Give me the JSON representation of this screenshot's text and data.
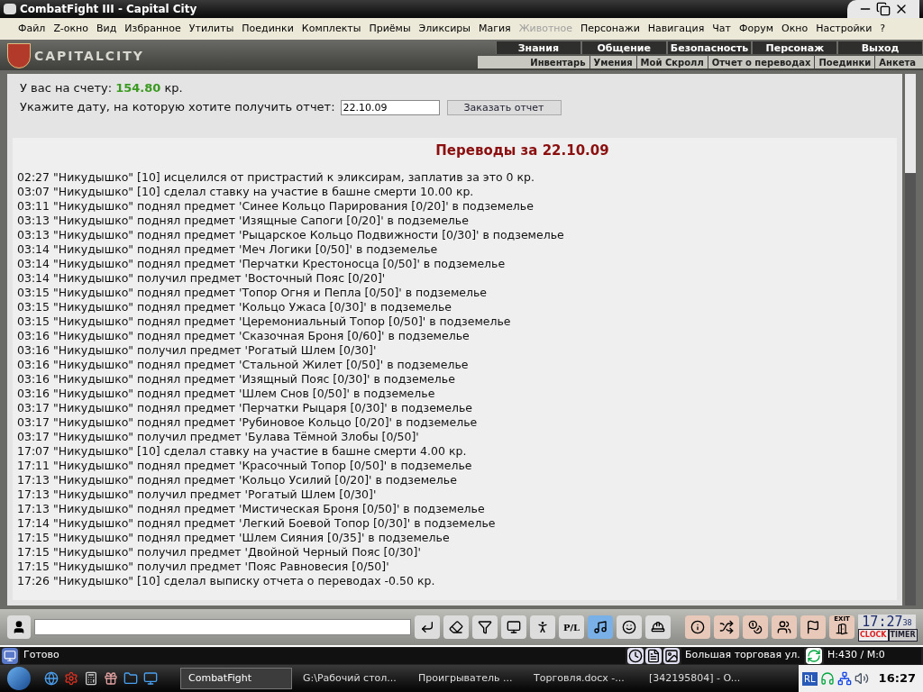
{
  "window": {
    "title": "CombatFight III - Capital City"
  },
  "menu": [
    {
      "label": "Файл",
      "disabled": false
    },
    {
      "label": "Z-окно",
      "disabled": false
    },
    {
      "label": "Вид",
      "disabled": false
    },
    {
      "label": "Избранное",
      "disabled": false
    },
    {
      "label": "Утилиты",
      "disabled": false
    },
    {
      "label": "Поединки",
      "disabled": false
    },
    {
      "label": "Комплекты",
      "disabled": false
    },
    {
      "label": "Приёмы",
      "disabled": false
    },
    {
      "label": "Эликсиры",
      "disabled": false
    },
    {
      "label": "Магия",
      "disabled": false
    },
    {
      "label": "Животное",
      "disabled": true
    },
    {
      "label": "Персонажи",
      "disabled": false
    },
    {
      "label": "Навигация",
      "disabled": false
    },
    {
      "label": "Чат",
      "disabled": false
    },
    {
      "label": "Форум",
      "disabled": false
    },
    {
      "label": "Окно",
      "disabled": false
    },
    {
      "label": "Настройки",
      "disabled": false
    },
    {
      "label": "?",
      "disabled": false
    }
  ],
  "header": {
    "logo": "CAPITALCITY",
    "top_nav": [
      "Знания",
      "Общение",
      "Безопасность",
      "Персонаж",
      "Выход"
    ],
    "sub_nav": [
      "Инвентарь",
      "Умения",
      "Мой Скролл",
      "Отчет о переводах",
      "Поединки",
      "Анкета"
    ]
  },
  "account": {
    "label": "У вас на счету:",
    "amount": "154.80",
    "currency": "кр."
  },
  "date_form": {
    "label": "Укажите дату, на которую хотите получить отчет:",
    "value": "22.10.09",
    "button": "Заказать отчет"
  },
  "report": {
    "title": "Переводы за 22.10.09",
    "lines": [
      "02:27 \"Никудышко\" [10] исцелился от пристрастий к эликсирам, заплатив за это 0 кр.",
      "03:07 \"Никудышко\" [10] сделал ставку на участие в башне смерти 10.00 кр.",
      "03:11 \"Никудышко\" поднял предмет 'Синее Кольцо Парирования [0/20]' в подземелье",
      "03:13 \"Никудышко\" поднял предмет 'Изящные Сапоги [0/20]' в подземелье",
      "03:13 \"Никудышко\" поднял предмет 'Рыцарское Кольцо Подвижности [0/30]' в подземелье",
      "03:14 \"Никудышко\" поднял предмет 'Меч Логики [0/50]' в подземелье",
      "03:14 \"Никудышко\" поднял предмет 'Перчатки Крестоносца [0/50]' в подземелье",
      "03:14 \"Никудышко\" получил предмет 'Восточный Пояс [0/20]'",
      "03:15 \"Никудышко\" поднял предмет 'Топор Огня и Пепла [0/50]' в подземелье",
      "03:15 \"Никудышко\" поднял предмет 'Кольцо Ужаса [0/30]' в подземелье",
      "03:15 \"Никудышко\" поднял предмет 'Церемониальный Топор [0/50]' в подземелье",
      "03:16 \"Никудышко\" поднял предмет 'Сказочная Броня [0/60]' в подземелье",
      "03:16 \"Никудышко\" получил предмет 'Рогатый Шлем [0/30]'",
      "03:16 \"Никудышко\" поднял предмет 'Стальной Жилет [0/50]' в подземелье",
      "03:16 \"Никудышко\" поднял предмет 'Изящный Пояс [0/30]' в подземелье",
      "03:16 \"Никудышко\" поднял предмет 'Шлем Снов [0/50]' в подземелье",
      "03:17 \"Никудышко\" поднял предмет 'Перчатки Рыцаря [0/30]' в подземелье",
      "03:17 \"Никудышко\" поднял предмет 'Рубиновое Кольцо [0/20]' в подземелье",
      "03:17 \"Никудышко\" получил предмет 'Булава Тёмной Злобы [0/50]'",
      "17:07 \"Никудышко\" [10] сделал ставку на участие в башне смерти 4.00 кр.",
      "17:11 \"Никудышко\" поднял предмет 'Красочный Топор [0/50]' в подземелье",
      "17:13 \"Никудышко\" поднял предмет 'Кольцо Усилий [0/20]' в подземелье",
      "17:13 \"Никудышко\" получил предмет 'Рогатый Шлем [0/30]'",
      "17:13 \"Никудышко\" поднял предмет 'Мистическая Броня [0/50]' в подземелье",
      "17:14 \"Никудышко\" поднял предмет 'Легкий Боевой Топор [0/30]' в подземелье",
      "17:15 \"Никудышко\" поднял предмет 'Шлем Сияния [0/35]' в подземелье",
      "17:15 \"Никудышко\" получил предмет 'Двойной Черный Пояс [0/30]'",
      "17:15 \"Никудышко\" получил предмет 'Пояс Равновесия [0/50]'",
      "17:26 \"Никудышко\" [10] сделал выписку отчета о переводах -0.50 кр."
    ]
  },
  "toolbar": {
    "pl_label": "P/L",
    "exit_label": "EXIT",
    "clock": {
      "time": "17:27",
      "seconds": "38",
      "clock_label": "CLOCK",
      "timer_label": "TIMER"
    }
  },
  "status_bar": {
    "status": "Готово",
    "location": "Большая торговая ул.",
    "hp_mana": "H:430 / M:0"
  },
  "taskbar": {
    "tasks": [
      {
        "label": "CombatFight",
        "selected": true
      },
      {
        "label": "G:\\Рабочий стол...",
        "selected": false
      },
      {
        "label": "Проигрыватель ...",
        "selected": false
      },
      {
        "label": "Торговля.docx -...",
        "selected": false
      },
      {
        "label": "[342195804] - O...",
        "selected": false
      }
    ],
    "language": "RL",
    "clock": "16:27"
  }
}
